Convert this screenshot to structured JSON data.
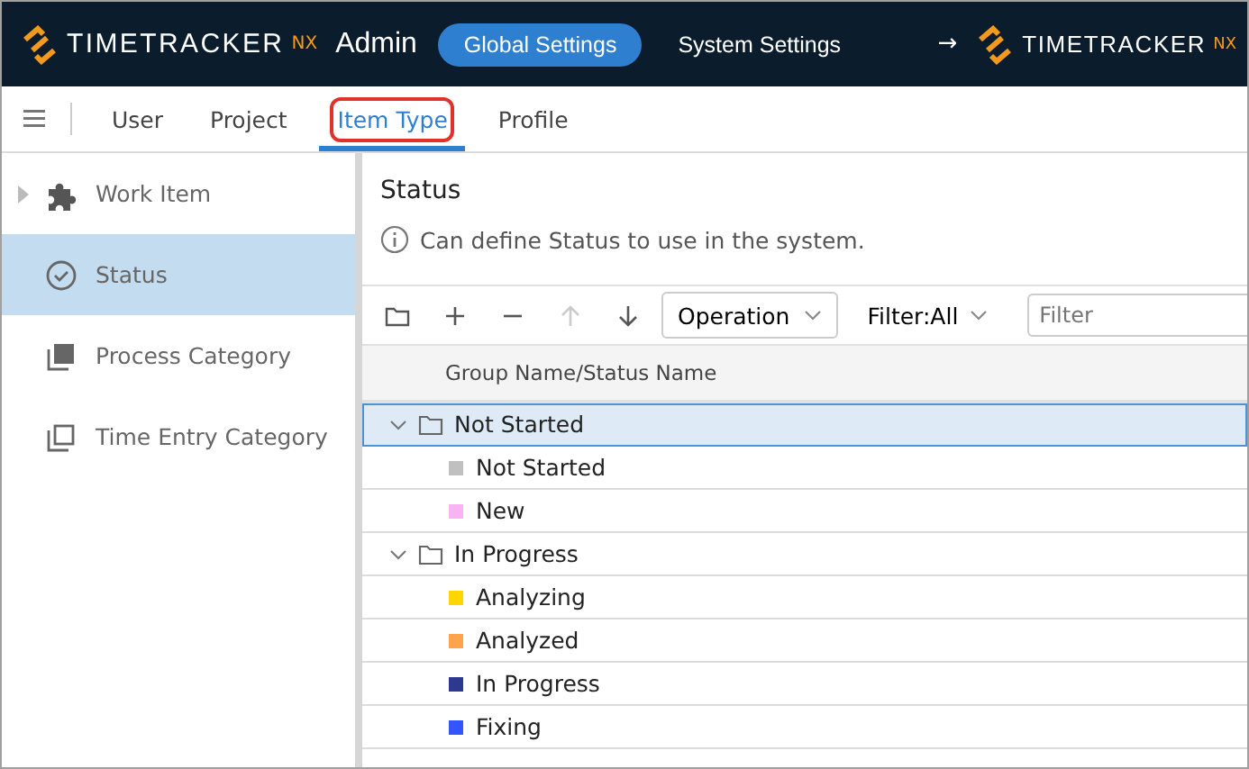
{
  "header": {
    "logo": {
      "brand": "TIMETRACKER",
      "suffix": "NX",
      "label": "Admin"
    },
    "tabs": [
      {
        "label": "Global Settings",
        "selected": true
      },
      {
        "label": "System Settings",
        "selected": false
      }
    ],
    "switch_arrow": "→",
    "right_logo": {
      "brand": "TIMETRACKER",
      "suffix": "NX"
    }
  },
  "nav": {
    "tabs": [
      {
        "label": "User",
        "selected": false,
        "highlighted": false
      },
      {
        "label": "Project",
        "selected": false,
        "highlighted": false
      },
      {
        "label": "Item Type",
        "selected": true,
        "highlighted": true
      },
      {
        "label": "Profile",
        "selected": false,
        "highlighted": false
      }
    ]
  },
  "sidebar": {
    "items": [
      {
        "label": "Work Item",
        "kind": "puzzle",
        "expandable": true,
        "selected": false
      },
      {
        "label": "Status",
        "kind": "check",
        "expandable": false,
        "selected": true
      },
      {
        "label": "Process Category",
        "kind": "stack-filled",
        "expandable": false,
        "selected": false
      },
      {
        "label": "Time Entry Category",
        "kind": "stack-outline",
        "expandable": false,
        "selected": false
      }
    ]
  },
  "content": {
    "title": "Status",
    "info": "Can define Status to use in the system.",
    "toolbar": {
      "buttons": [
        {
          "kind": "folder",
          "disabled": false
        },
        {
          "kind": "add",
          "disabled": false
        },
        {
          "kind": "remove",
          "disabled": false
        },
        {
          "kind": "up",
          "disabled": true
        },
        {
          "kind": "down",
          "disabled": false
        }
      ],
      "operation": "Operation",
      "filter_menu": "Filter:All",
      "filter_placeholder": "Filter"
    },
    "table": {
      "columns": [
        "Group Name/Status Name"
      ],
      "rows": [
        {
          "name": "Not Started",
          "expanded": true,
          "selected": true,
          "children": [
            {
              "name": "Not Started",
              "color": "#c0c0c0",
              "selected": false
            },
            {
              "name": "New",
              "color": "#f9b3f3",
              "selected": false
            }
          ]
        },
        {
          "name": "In Progress",
          "expanded": true,
          "selected": false,
          "children": [
            {
              "name": "Analyzing",
              "color": "#ffd600",
              "selected": false
            },
            {
              "name": "Analyzed",
              "color": "#ffa34d",
              "selected": false
            },
            {
              "name": "In Progress",
              "color": "#2b3a8f",
              "selected": false
            },
            {
              "name": "Fixing",
              "color": "#3355ff",
              "selected": false
            }
          ]
        }
      ]
    }
  }
}
